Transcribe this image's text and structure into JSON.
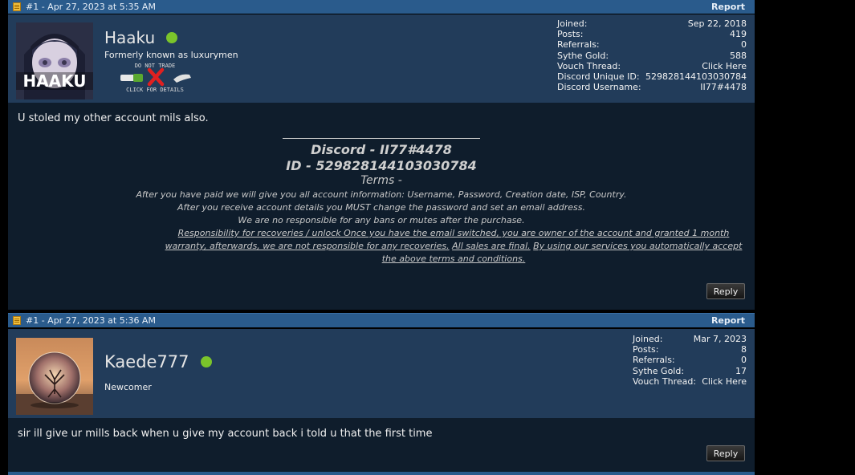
{
  "posts": [
    {
      "post_number": "#1 - Apr 27, 2023 at 5:35 AM",
      "report_label": "Report",
      "username": "Haaku",
      "usertitle": "Formerly known as luxurymen",
      "trade_badge": {
        "top_text": "DO NOT TRADE",
        "bottom_text": "CLICK FOR DETAILS"
      },
      "avatar_text": "HAAKU",
      "stats": [
        {
          "label": "Joined:",
          "value": "Sep 22, 2018"
        },
        {
          "label": "Posts:",
          "value": "419"
        },
        {
          "label": "Referrals:",
          "value": "0"
        },
        {
          "label": "Sythe Gold:",
          "value": "588"
        },
        {
          "label": "Vouch Thread:",
          "value": "Click Here"
        },
        {
          "label": "Discord Unique ID:",
          "value": "529828144103030784"
        },
        {
          "label": "Discord Username:",
          "value": "II77#4478"
        }
      ],
      "message": "U stoled my other account mils also.",
      "signature": {
        "discord": "Discord - II77#4478",
        "id": "ID - 529828144103030784",
        "terms_heading": "Terms -",
        "line1": "After you have paid we will give you all account information: Username, Password, Creation date, ISP, Country.",
        "line2": "After you receive account details you MUST change the password and set an email address.",
        "line3": "We are no responsible for any bans or mutes after the purchase.",
        "para_a": "Responsibility for recoveries / unlock Once you have the email switched, you are owner of the account and granted 1 month warranty, afterwards, we are not responsible for any recoveries.",
        "para_b": "All sales are final.",
        "para_c": "By using our services you automatically accept the above terms and conditions."
      },
      "reply_label": "Reply"
    },
    {
      "post_number": "#1 - Apr 27, 2023 at 5:36 AM",
      "report_label": "Report",
      "username": "Kaede777",
      "usertitle": "Newcomer",
      "stats": [
        {
          "label": "Joined:",
          "value": "Mar 7, 2023"
        },
        {
          "label": "Posts:",
          "value": "8"
        },
        {
          "label": "Referrals:",
          "value": "0"
        },
        {
          "label": "Sythe Gold:",
          "value": "17"
        },
        {
          "label": "Vouch Thread:",
          "value": "Click Here"
        }
      ],
      "message": "sir ill give ur mills back when u give my account back i told u that the first time",
      "reply_label": "Reply"
    }
  ],
  "colors": {
    "header_blue": "#2a5b8c",
    "user_bar": "#223c5a",
    "body": "#0f1d2c",
    "online": "#7bc42b"
  }
}
